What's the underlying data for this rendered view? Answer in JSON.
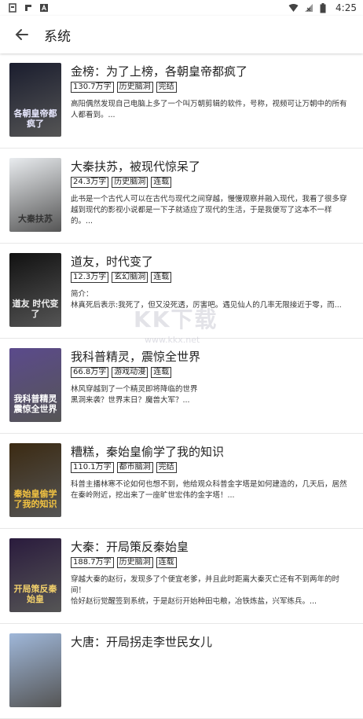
{
  "status": {
    "time": "4:25"
  },
  "appbar": {
    "title": "系统"
  },
  "watermark": {
    "main": "KK下载",
    "url": "www.kkx.net"
  },
  "books": [
    {
      "title": "金榜：为了上榜，各朝皇帝都疯了",
      "tags": [
        "130.7万字",
        "历史脑洞",
        "完结"
      ],
      "desc": "高阳偶然发现自己电脑上多了一个叫万朝剪辑的软件，号称，视频可让万朝中的所有人都看到。...",
      "cover": {
        "bg": "#1a1d2e",
        "text": "各朝皇帝都疯了",
        "accent": "#e8e8ff"
      }
    },
    {
      "title": "大秦扶苏，被现代惊呆了",
      "tags": [
        "24.3万字",
        "历史脑洞",
        "连载"
      ],
      "desc": "此书是一个古代人可以在古代与现代之间穿越，慢慢观察并融入现代，我看了很多穿越到现代的影视小说都是一下子就适应了现代的生活，于是我便写了这本不一样的。...",
      "cover": {
        "bg": "#e9ecef",
        "text": "大秦扶苏",
        "accent": "#333"
      }
    },
    {
      "title": "道友，时代变了",
      "tags": [
        "12.3万字",
        "玄幻脑洞",
        "连载"
      ],
      "desc": "简介：\n林真死后表示:我死了，但又没死透，厉害吧。遇见仙人的几率无限接近于零，而...",
      "cover": {
        "bg": "#111111",
        "text": "道友 时代变了",
        "accent": "#f0f0f0"
      }
    },
    {
      "title": "我科普精灵，震惊全世界",
      "tags": [
        "66.8万字",
        "游戏动漫",
        "连载"
      ],
      "desc": "林风穿越到了一个精灵即将降临的世界\n黑洞来袭？世界末日？魔兽大军？...",
      "cover": {
        "bg": "#5b4a8c",
        "text": "我科普精灵震惊全世界",
        "accent": "#ffffff"
      }
    },
    {
      "title": "糟糕，秦始皇偷学了我的知识",
      "tags": [
        "110.1万字",
        "都市脑洞",
        "完结"
      ],
      "desc": "科普主播林寒不论如何也想不到，他给观众科普金字塔是如何建造的，几天后，居然在秦岭附近，挖出来了一座旷世宏伟的金字塔！...",
      "cover": {
        "bg": "#3b2a12",
        "text": "秦始皇偷学了我的知识",
        "accent": "#f5c542"
      }
    },
    {
      "title": "大秦：开局策反秦始皇",
      "tags": [
        "188.7万字",
        "历史脑洞",
        "连载"
      ],
      "desc": "穿越大秦的赵衍，发现多了个便宜老爹，并且此时距离大秦灭亡还有不到两年的时间！\n恰好赵衍觉醒签到系统，于是赵衍开始种田屯粮，冶铁炼盐，兴军练兵。...",
      "cover": {
        "bg": "#2a1b3d",
        "text": "开局策反秦始皇",
        "accent": "#f2d06b"
      }
    },
    {
      "title": "大唐：开局拐走李世民女儿",
      "tags": [],
      "desc": "",
      "cover": {
        "bg": "#9fb7d9",
        "text": "",
        "accent": "#fff"
      }
    }
  ]
}
